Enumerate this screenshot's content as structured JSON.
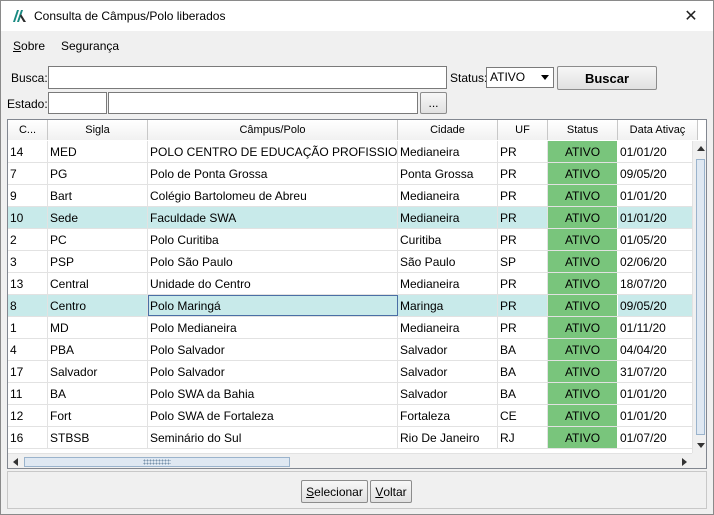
{
  "window": {
    "title": "Consulta de Câmpus/Polo liberados",
    "close": "✕"
  },
  "menu": {
    "sobre": {
      "u": "S",
      "rest": "obre"
    },
    "seguranca": {
      "label": "Segurança"
    }
  },
  "search": {
    "busca_label": "Busca:",
    "busca_value": "",
    "status_label": "Status:",
    "status_value": "ATIVO",
    "buscar_button": "Buscar",
    "estado_label": "Estado:",
    "estado_code": "",
    "estado_name": "",
    "browse_button": "..."
  },
  "grid": {
    "columns": [
      "C...",
      "Sigla",
      "Câmpus/Polo",
      "Cidade",
      "UF",
      "Status",
      "Data Ativaç"
    ],
    "rows": [
      [
        "14",
        "MED",
        " POLO CENTRO DE EDUCAÇÃO PROFISSION...",
        "Medianeira",
        "PR",
        "ATIVO",
        "01/01/20"
      ],
      [
        "7",
        "PG",
        "Polo de Ponta Grossa",
        "Ponta Grossa",
        "PR",
        "ATIVO",
        "09/05/20"
      ],
      [
        "9",
        "Bart",
        "Colégio Bartolomeu de Abreu",
        "Medianeira",
        "PR",
        "ATIVO",
        "01/01/20"
      ],
      [
        "10",
        "Sede",
        "Faculdade SWA",
        "Medianeira",
        "PR",
        "ATIVO",
        "01/01/20"
      ],
      [
        "2",
        "PC",
        "Polo Curitiba",
        "Curitiba",
        "PR",
        "ATIVO",
        "01/05/20"
      ],
      [
        "3",
        "PSP",
        "Polo São Paulo",
        "São Paulo",
        "SP",
        "ATIVO",
        "02/06/20"
      ],
      [
        "13",
        "Central",
        "Unidade do Centro",
        "Medianeira",
        "PR",
        "ATIVO",
        "18/07/20"
      ],
      [
        "8",
        "Centro",
        "Polo Maringá",
        "Maringa",
        "PR",
        "ATIVO",
        "09/05/20"
      ],
      [
        "1",
        "MD",
        "Polo Medianeira",
        "Medianeira",
        "PR",
        "ATIVO",
        "01/11/20"
      ],
      [
        "4",
        "PBA",
        "Polo Salvador",
        "Salvador",
        "BA",
        "ATIVO",
        "04/04/20"
      ],
      [
        "17",
        "Salvador",
        "Polo Salvador",
        "Salvador",
        "BA",
        "ATIVO",
        "31/07/20"
      ],
      [
        "11",
        "BA",
        "Polo SWA da Bahia",
        "Salvador",
        "BA",
        "ATIVO",
        "01/01/20"
      ],
      [
        "12",
        "Fort",
        "Polo SWA de Fortaleza",
        "Fortaleza",
        "CE",
        "ATIVO",
        "01/01/20"
      ],
      [
        "16",
        "STBSB",
        "Seminário do Sul",
        "Rio De Janeiro",
        "RJ",
        "ATIVO",
        "01/07/20"
      ]
    ],
    "selected_rows": [
      3,
      7
    ],
    "status_color": "#79c57c",
    "selected_color": "#c8eaea"
  },
  "footer": {
    "selecionar": {
      "u": "S",
      "rest": "elecionar"
    },
    "voltar": {
      "u": "V",
      "rest": "oltar"
    }
  }
}
